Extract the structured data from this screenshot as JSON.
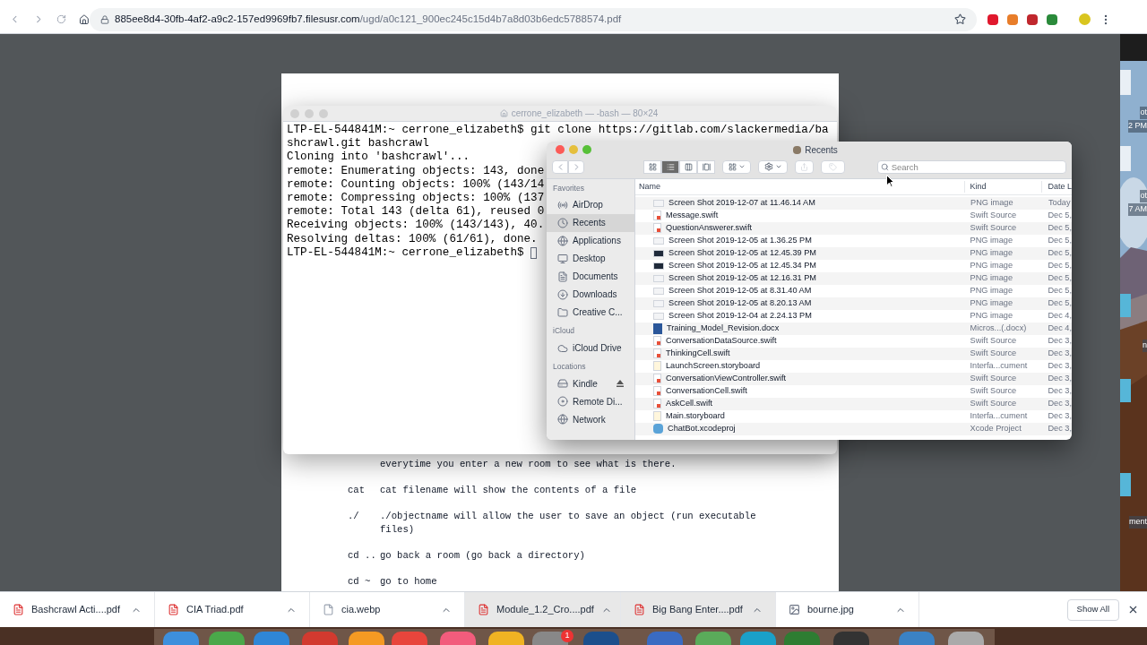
{
  "browser": {
    "url_host": "885ee8d4-30fb-4af2-a9c2-157ed9969fb7.filesusr.com",
    "url_path": "/ugd/a0c121_900ec245c15d4b7a8d03b6edc5788574.pdf"
  },
  "terminal": {
    "title": "cerrone_elizabeth — -bash — 80×24",
    "lines": [
      "LTP-EL-544841M:~ cerrone_elizabeth$ git clone https://gitlab.com/slackermedia/ba",
      "shcrawl.git bashcrawl",
      "Cloning into 'bashcrawl'...",
      "remote: Enumerating objects: 143, done",
      "remote: Counting objects: 100% (143/14",
      "remote: Compressing objects: 100% (137",
      "remote: Total 143 (delta 61), reused 0",
      "Receiving objects: 100% (143/143), 40.",
      "Resolving deltas: 100% (61/61), done."
    ],
    "prompt": "LTP-EL-544841M:~ cerrone_elizabeth$ "
  },
  "finder": {
    "title": "Recents",
    "search_placeholder": "Search",
    "view_buttons": [
      {
        "selected": false
      },
      {
        "selected": true
      },
      {
        "selected": false
      },
      {
        "selected": false
      }
    ],
    "sidebar": [
      {
        "heading": "Favorites",
        "items": [
          {
            "label": "AirDrop",
            "selected": false
          },
          {
            "label": "Recents",
            "selected": true
          },
          {
            "label": "Applications",
            "selected": false
          },
          {
            "label": "Desktop",
            "selected": false
          },
          {
            "label": "Documents",
            "selected": false
          },
          {
            "label": "Downloads",
            "selected": false
          },
          {
            "label": "Creative C...",
            "selected": false
          }
        ]
      },
      {
        "heading": "iCloud",
        "items": [
          {
            "label": "iCloud Drive",
            "selected": false
          }
        ]
      },
      {
        "heading": "Locations",
        "items": [
          {
            "label": "Kindle",
            "selected": false
          },
          {
            "label": "Remote Di...",
            "selected": false
          },
          {
            "label": "Network",
            "selected": false
          }
        ]
      }
    ],
    "columns": [
      "Name",
      "Kind",
      "Date L"
    ],
    "rows": [
      {
        "name": "Screen Shot 2019-12-07 at 11.46.14 AM",
        "kind": "PNG image",
        "date": "Today"
      },
      {
        "name": "Message.swift",
        "kind": "Swift Source",
        "date": "Dec 5,"
      },
      {
        "name": "QuestionAnswerer.swift",
        "kind": "Swift Source",
        "date": "Dec 5,"
      },
      {
        "name": "Screen Shot 2019-12-05 at 1.36.25 PM",
        "kind": "PNG image",
        "date": "Dec 5,"
      },
      {
        "name": "Screen Shot 2019-12-05 at 12.45.39 PM",
        "kind": "PNG image",
        "date": "Dec 5,"
      },
      {
        "name": "Screen Shot 2019-12-05 at 12.45.34 PM",
        "kind": "PNG image",
        "date": "Dec 5,"
      },
      {
        "name": "Screen Shot 2019-12-05 at 12.16.31 PM",
        "kind": "PNG image",
        "date": "Dec 5,"
      },
      {
        "name": "Screen Shot 2019-12-05 at 8.31.40 AM",
        "kind": "PNG image",
        "date": "Dec 5,"
      },
      {
        "name": "Screen Shot 2019-12-05 at 8.20.13 AM",
        "kind": "PNG image",
        "date": "Dec 5,"
      },
      {
        "name": "Screen Shot 2019-12-04 at 2.24.13 PM",
        "kind": "PNG image",
        "date": "Dec 4,"
      },
      {
        "name": "Training_Model_Revision.docx",
        "kind": "Micros...(.docx)",
        "date": "Dec 4,"
      },
      {
        "name": "ConversationDataSource.swift",
        "kind": "Swift Source",
        "date": "Dec 3,"
      },
      {
        "name": "ThinkingCell.swift",
        "kind": "Swift Source",
        "date": "Dec 3,"
      },
      {
        "name": "LaunchScreen.storyboard",
        "kind": "Interfa...cument",
        "date": "Dec 3,"
      },
      {
        "name": "ConversationViewController.swift",
        "kind": "Swift Source",
        "date": "Dec 3,"
      },
      {
        "name": "ConversationCell.swift",
        "kind": "Swift Source",
        "date": "Dec 3,"
      },
      {
        "name": "AskCell.swift",
        "kind": "Swift Source",
        "date": "Dec 3,"
      },
      {
        "name": "Main.storyboard",
        "kind": "Interfa...cument",
        "date": "Dec 3,"
      },
      {
        "name": "ChatBot.xcodeproj",
        "kind": "Xcode Project",
        "date": "Dec 3,"
      }
    ]
  },
  "pdf": {
    "entries": [
      {
        "lines": [
          "everytime you enter a new room to see what is there."
        ]
      },
      {
        "command": "cat",
        "lines": [
          "cat filename will show the contents of a file"
        ]
      },
      {
        "command": "./",
        "lines": [
          "./objectname will allow the user to save an object (run executable",
          "files)"
        ]
      },
      {
        "command": "cd ..",
        "lines": [
          "go back a room (go back a directory)"
        ]
      },
      {
        "command": "cd ~",
        "lines": [
          "go to home"
        ]
      }
    ]
  },
  "desktop_labels": [
    "ot",
    "2 PM",
    "ot",
    "7 AM",
    "n",
    "ment"
  ],
  "downloads": {
    "items": [
      {
        "name": "Bashcrawl Acti....pdf",
        "highlighted": false
      },
      {
        "name": "CIA Triad.pdf",
        "highlighted": false
      },
      {
        "name": "cia.webp",
        "highlighted": false
      },
      {
        "name": "Module_1.2_Cro....pdf",
        "highlighted": true
      },
      {
        "name": "Big Bang Enter....pdf",
        "highlighted": true
      },
      {
        "name": "bourne.jpg",
        "highlighted": false
      }
    ],
    "show_all": "Show All"
  },
  "dock": {
    "badge": "1"
  }
}
